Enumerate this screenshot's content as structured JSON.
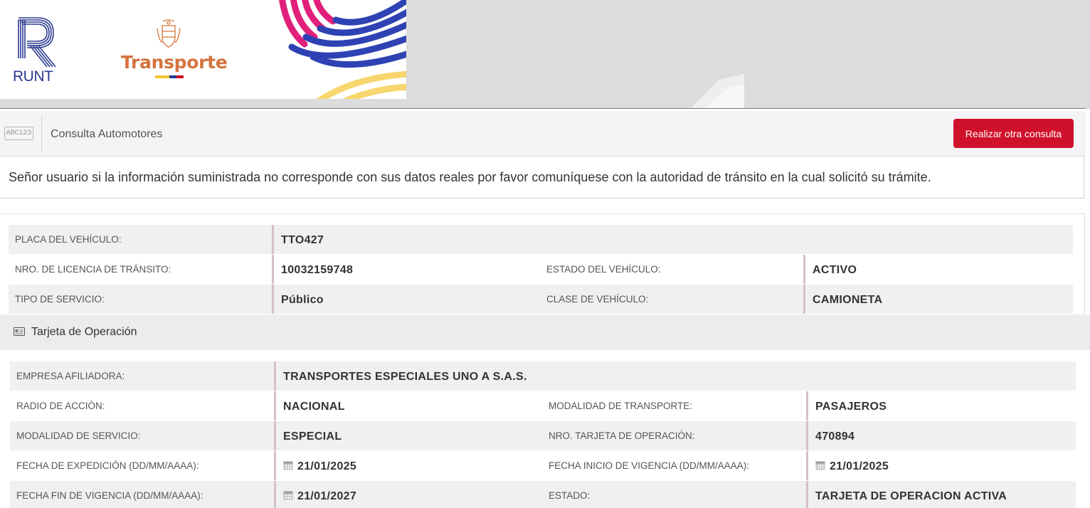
{
  "header": {
    "runt_logo_text": "RUNT",
    "ministry_logo_text": "Transporte",
    "flag_colors": [
      "#f4c430",
      "#1f3c91",
      "#ce1126"
    ]
  },
  "toolbar": {
    "plate_icon_text": "ABC123",
    "title": "Consulta Automotores",
    "new_query_label": "Realizar otra consulta"
  },
  "notice": {
    "text": "Señor usuario si la información suministrada no corresponde con sus datos reales por favor comuníquese con la autoridad de tránsito en la cual solicitó su trámite."
  },
  "vehicle": {
    "plate_label": "PLACA DEL VEHÍCULO:",
    "plate_value": "TTO427",
    "license_label": "NRO. DE LICENCIA DE TRÁNSITO:",
    "license_value": "10032159748",
    "status_label": "ESTADO DEL VEHÍCULO:",
    "status_value": "ACTIVO",
    "service_type_label": "TIPO DE SERVICIO:",
    "service_type_value": "Público",
    "vehicle_class_label": "CLASE DE VEHÍCULO:",
    "vehicle_class_value": "CAMIONETA"
  },
  "operation_card": {
    "section_title": "Tarjeta de Operación",
    "company_label": "EMPRESA AFILIADORA:",
    "company_value": "TRANSPORTES ESPECIALES UNO A S.A.S.",
    "radius_label": "RADIO DE ACCIÓN:",
    "radius_value": "NACIONAL",
    "transport_mode_label": "MODALIDAD DE TRANSPORTE:",
    "transport_mode_value": "PASAJEROS",
    "service_mode_label": "MODALIDAD DE SERVICIO:",
    "service_mode_value": "ESPECIAL",
    "card_number_label": "NRO. TARJETA DE OPERACIÓN:",
    "card_number_value": "470894",
    "issue_date_label": "FECHA DE EXPEDICIÓN (DD/MM/AAAA):",
    "issue_date_value": "21/01/2025",
    "start_date_label": "FECHA INICIO DE VIGENCIA (DD/MM/AAAA):",
    "start_date_value": "21/01/2025",
    "end_date_label": "FECHA FIN DE VIGENCIA (DD/MM/AAAA):",
    "end_date_value": "21/01/2027",
    "card_status_label": "ESTADO:",
    "card_status_value": "TARJETA DE OPERACION ACTIVA"
  },
  "colors": {
    "primary_button": "#d0112b",
    "value_border": "#d7bfc4",
    "runt_blue": "#2b3a8f",
    "transporte_orange": "#d5733d"
  },
  "icons": {
    "plate": "license-plate-icon",
    "card": "id-card-icon",
    "calendar": "calendar-icon"
  }
}
